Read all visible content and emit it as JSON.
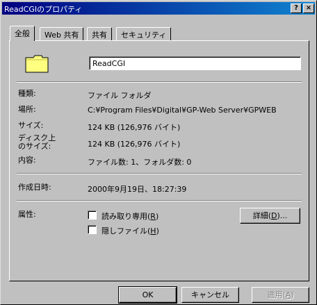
{
  "window": {
    "title": "ReadCGIのプロパティ",
    "help_button": "?",
    "close_button": "×"
  },
  "tabs": [
    {
      "label": "全般"
    },
    {
      "label": "Web 共有"
    },
    {
      "label": "共有"
    },
    {
      "label": "セキュリティ"
    }
  ],
  "general": {
    "name_value": "ReadCGI",
    "rows": [
      {
        "label": "種類:",
        "value": "ファイル フォルダ"
      },
      {
        "label": "場所:",
        "value": "C:¥Program Files¥Digital¥GP-Web Server¥GPWEB"
      },
      {
        "label": "サイズ:",
        "value": "124 KB (126,976 バイト)"
      },
      {
        "label_line1": "ディスク上",
        "label_line2": "のサイズ:",
        "value": "124 KB (126,976 バイト)"
      },
      {
        "label": "内容:",
        "value": "ファイル数: 1、フォルダ数: 0"
      }
    ],
    "created_label": "作成日時:",
    "created_value": "2000年9月19日、18:27:39",
    "attributes_label": "属性:",
    "readonly_label": "読み取り専用(",
    "readonly_key": "R",
    "hidden_label": "隠しファイル(",
    "hidden_key": "H",
    "details_label": "詳細(",
    "details_key": "D",
    "details_suffix": ")..."
  },
  "footer": {
    "ok": "OK",
    "cancel": "キャンセル",
    "apply_label": "適用(",
    "apply_key": "A"
  },
  "colors": {
    "titlebar_start": "#000080",
    "titlebar_end": "#1084d0",
    "face": "#c0c0c0",
    "folder": "#ffff80"
  },
  "icons": {
    "folder": "folder-icon"
  }
}
